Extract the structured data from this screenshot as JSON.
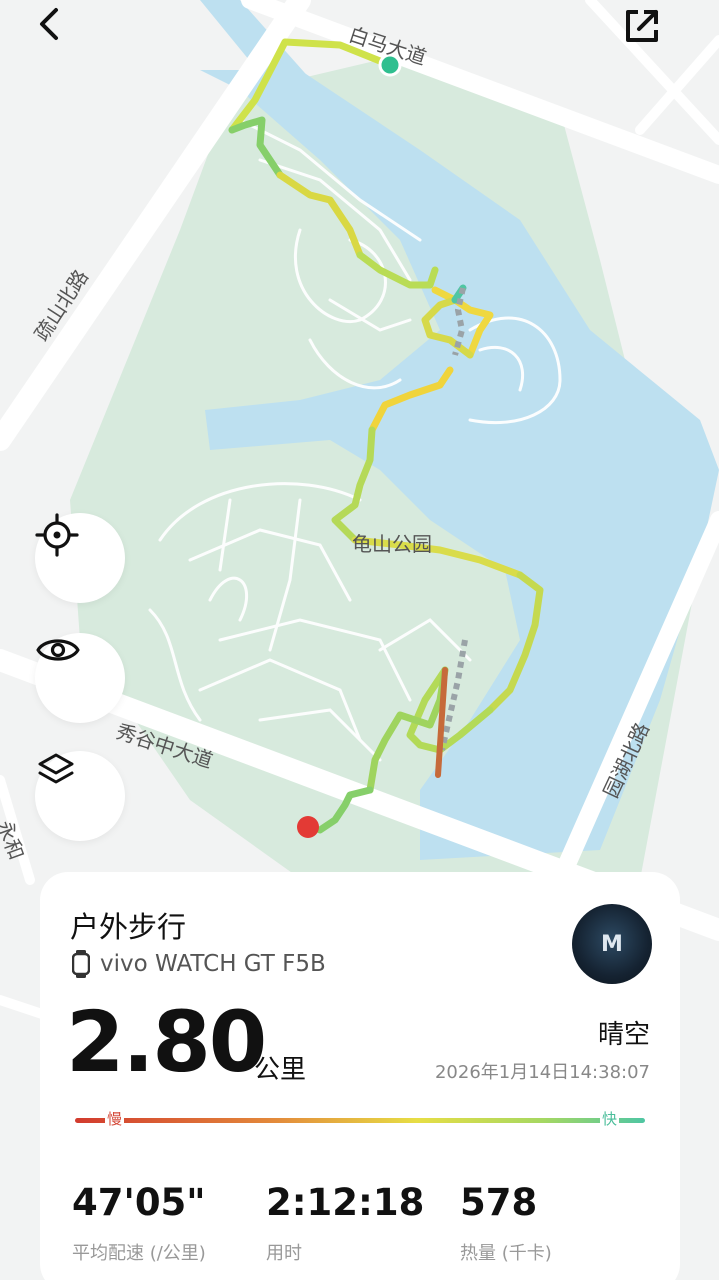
{
  "map": {
    "labels": {
      "road_top": "白马大道",
      "road_left": "疏山北路",
      "park": "龟山公园",
      "road_bottom": "秀谷中大道",
      "road_right": "园湖北路",
      "road_bottom_left": "永和"
    },
    "icons": {
      "back": "chevron-left-icon",
      "share": "external-link-icon",
      "locate": "crosshair-icon",
      "eye": "eye-icon",
      "layers": "layers-icon"
    },
    "colors": {
      "land": "#f2f3f3",
      "park": "#d7eadd",
      "water": "#bde0f0",
      "road": "#ffffff",
      "start_marker": "#2fbf8f",
      "end_marker": "#e33a35"
    }
  },
  "summary": {
    "activity": "户外步行",
    "device": "vivo WATCH GT F5B",
    "avatar_text": "M",
    "distance": "2.80",
    "distance_unit": "公里",
    "weather": "晴空",
    "datetime": "2026年1月14日14:38:07",
    "pace_slow": "慢",
    "pace_fast": "快",
    "stats": [
      {
        "value": "47'05\"",
        "label": "平均配速 (/公里)"
      },
      {
        "value": "2:12:18",
        "label": "用时"
      },
      {
        "value": "578",
        "label": "热量 (千卡)"
      }
    ]
  }
}
